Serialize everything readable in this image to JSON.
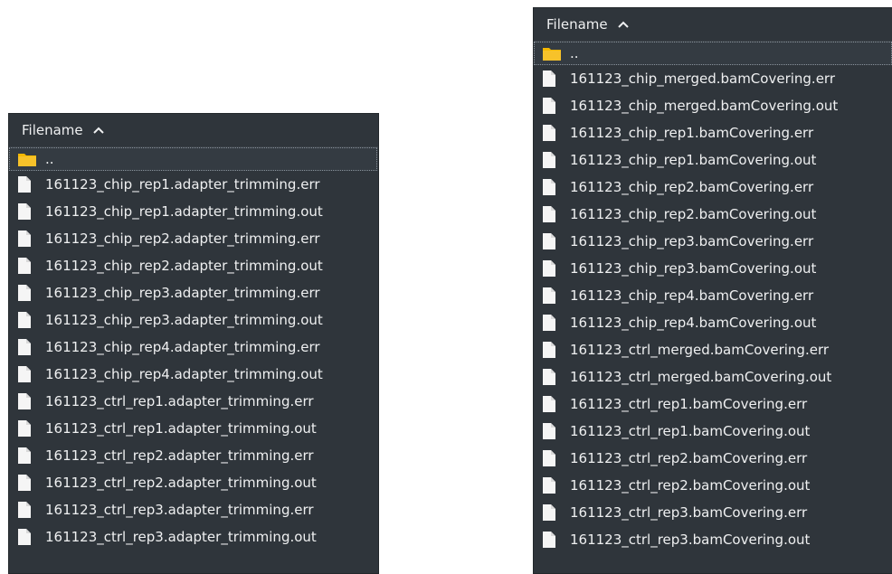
{
  "left_panel": {
    "header": {
      "column_label": "Filename"
    },
    "parent_label": "..",
    "files": [
      "161123_chip_rep1.adapter_trimming.err",
      "161123_chip_rep1.adapter_trimming.out",
      "161123_chip_rep2.adapter_trimming.err",
      "161123_chip_rep2.adapter_trimming.out",
      "161123_chip_rep3.adapter_trimming.err",
      "161123_chip_rep3.adapter_trimming.out",
      "161123_chip_rep4.adapter_trimming.err",
      "161123_chip_rep4.adapter_trimming.out",
      "161123_ctrl_rep1.adapter_trimming.err",
      "161123_ctrl_rep1.adapter_trimming.out",
      "161123_ctrl_rep2.adapter_trimming.err",
      "161123_ctrl_rep2.adapter_trimming.out",
      "161123_ctrl_rep3.adapter_trimming.err",
      "161123_ctrl_rep3.adapter_trimming.out"
    ]
  },
  "right_panel": {
    "header": {
      "column_label": "Filename"
    },
    "parent_label": "..",
    "files": [
      "161123_chip_merged.bamCovering.err",
      "161123_chip_merged.bamCovering.out",
      "161123_chip_rep1.bamCovering.err",
      "161123_chip_rep1.bamCovering.out",
      "161123_chip_rep2.bamCovering.err",
      "161123_chip_rep2.bamCovering.out",
      "161123_chip_rep3.bamCovering.err",
      "161123_chip_rep3.bamCovering.out",
      "161123_chip_rep4.bamCovering.err",
      "161123_chip_rep4.bamCovering.out",
      "161123_ctrl_merged.bamCovering.err",
      "161123_ctrl_merged.bamCovering.out",
      "161123_ctrl_rep1.bamCovering.err",
      "161123_ctrl_rep1.bamCovering.out",
      "161123_ctrl_rep2.bamCovering.err",
      "161123_ctrl_rep2.bamCovering.out",
      "161123_ctrl_rep3.bamCovering.err",
      "161123_ctrl_rep3.bamCovering.out"
    ]
  },
  "icons": {
    "sort": "chevron-up-icon",
    "parent": "folder-icon",
    "file": "file-icon"
  },
  "colors": {
    "panel_bg": "#2f353b",
    "text": "#eff0f1",
    "folder": "#f5b800",
    "file": "#f5f5f5"
  }
}
